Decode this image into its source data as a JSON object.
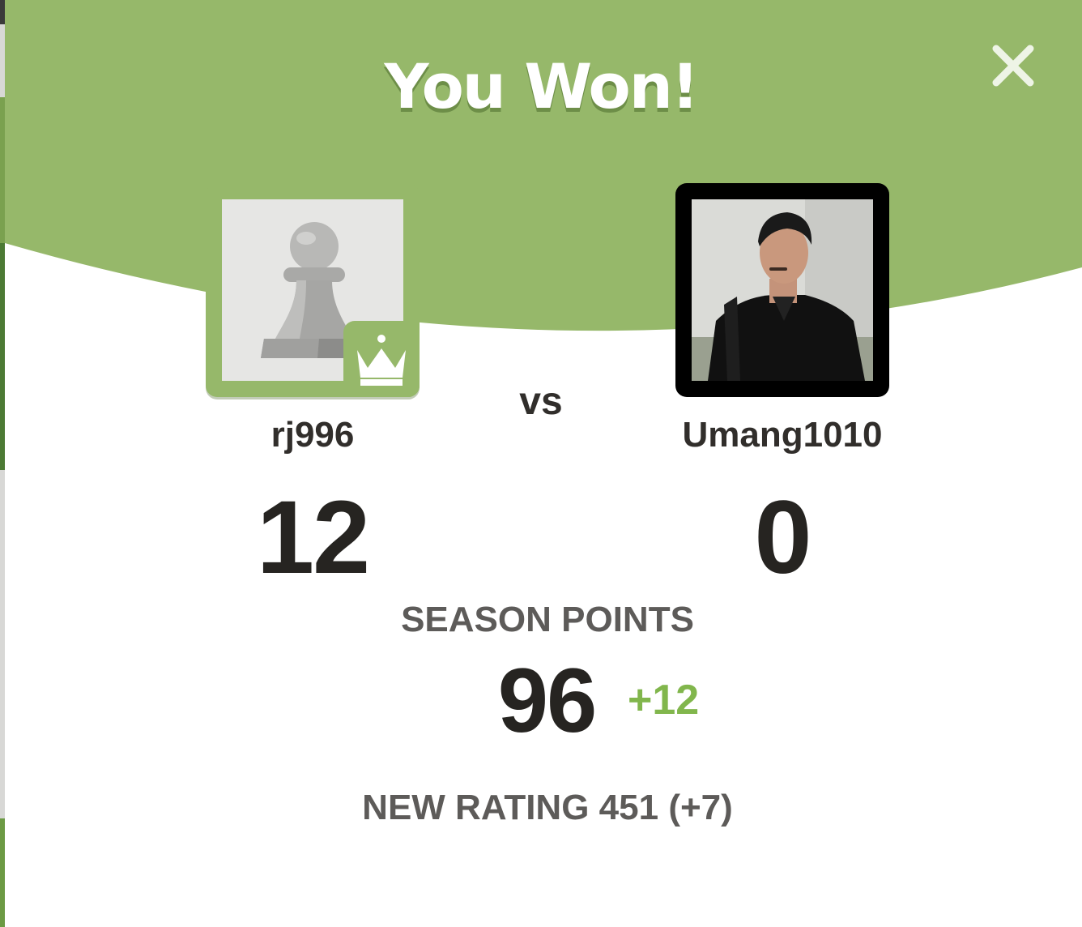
{
  "modal": {
    "title": "You Won!",
    "close_icon": "close-icon",
    "colors": {
      "header_green": "#96b86a",
      "accent_green": "#81b64c",
      "text_dark": "#262421",
      "text_muted": "#5d5b59"
    }
  },
  "players": {
    "left": {
      "username": "rj996",
      "score": "12",
      "avatar_icon": "pawn-icon",
      "badge_icon": "crown-icon"
    },
    "vs_label": "vs",
    "right": {
      "username": "Umang1010",
      "score": "0",
      "avatar_icon": "user-photo"
    }
  },
  "season": {
    "label": "SEASON POINTS",
    "points": "96",
    "delta": "+12"
  },
  "rating": {
    "label": "NEW RATING",
    "value": "451",
    "delta": "(+7)"
  }
}
